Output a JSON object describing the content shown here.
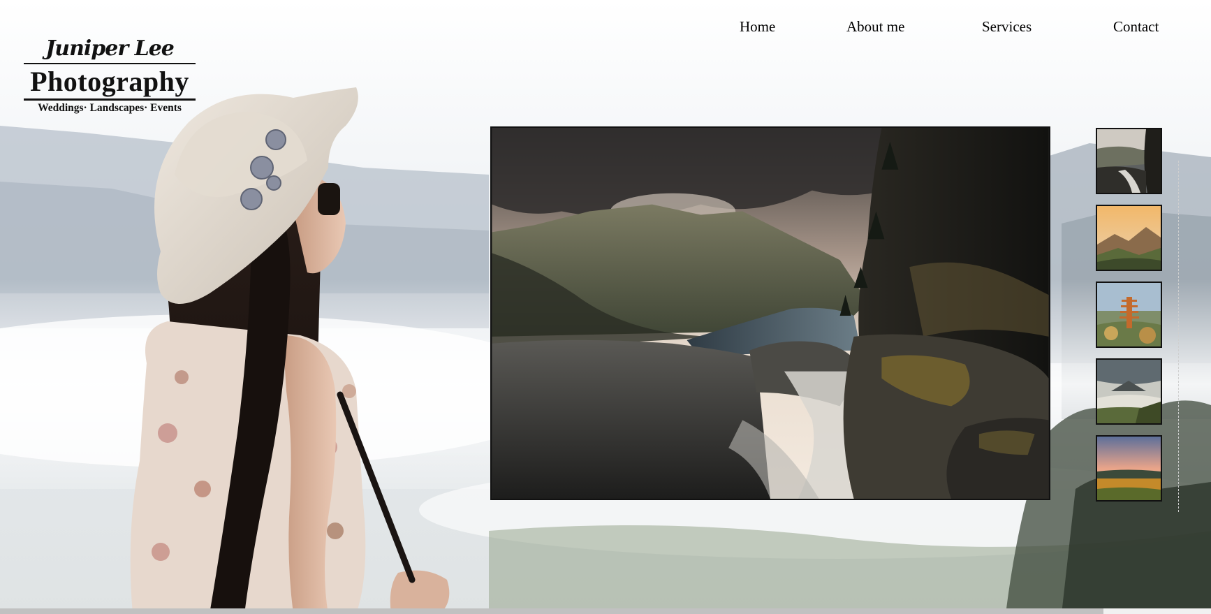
{
  "logo": {
    "script": "Juniper Lee",
    "main": "Photography",
    "tagline": "Weddings· Landscapes· Events"
  },
  "nav": {
    "items": [
      {
        "label": "Home"
      },
      {
        "label": "About me"
      },
      {
        "label": "Services"
      },
      {
        "label": "Contact"
      }
    ]
  },
  "gallery": {
    "main_photo": "mountain-lake-waterfall-photo",
    "thumbnails": [
      {
        "icon": "waterfall-thumbnail"
      },
      {
        "icon": "sunset-mountains-thumbnail"
      },
      {
        "icon": "pagoda-thumbnail"
      },
      {
        "icon": "volcano-valley-thumbnail"
      },
      {
        "icon": "meadow-sunset-thumbnail"
      }
    ]
  },
  "colors": {
    "text": "#000000",
    "border": "#111111",
    "background_sky": "#eef1f5"
  }
}
